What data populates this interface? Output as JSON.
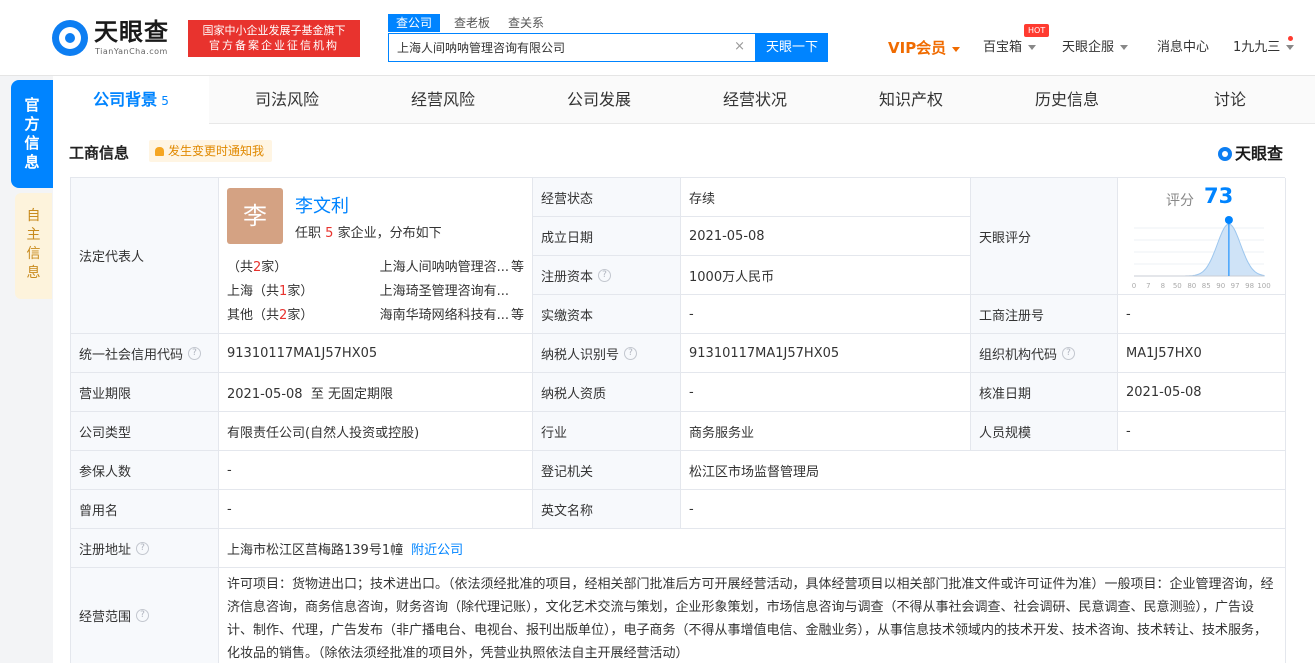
{
  "header": {
    "logo_text": "天眼查",
    "logo_sub": "TianYanCha.com",
    "gov_badge_line1": "国家中小企业发展子基金旗下",
    "gov_badge_line2": "官方备案企业征信机构",
    "search_tabs": [
      "查公司",
      "查老板",
      "查关系"
    ],
    "search_value": "上海人间呐呐管理咨询有限公司",
    "search_clear": "×",
    "search_button": "天眼一下",
    "nav": {
      "vip": "VIP会员",
      "treasure": "百宝箱",
      "hot": "HOT",
      "enterprise": "天眼企服",
      "messages": "消息中心",
      "user": "1九九三"
    }
  },
  "side": {
    "official": "官方信息",
    "self": "自主信息"
  },
  "tabs": [
    {
      "label": "公司背景",
      "count": "5"
    },
    {
      "label": "司法风险"
    },
    {
      "label": "经营风险"
    },
    {
      "label": "公司发展"
    },
    {
      "label": "经营状况"
    },
    {
      "label": "知识产权"
    },
    {
      "label": "历史信息"
    },
    {
      "label": "讨论"
    }
  ],
  "section": {
    "title": "工商信息",
    "notify": "发生变更时通知我",
    "brand": "天眼查"
  },
  "legal": {
    "label": "法定代表人",
    "avatar": "李",
    "name": "李文利",
    "sub_prefix": "任职",
    "sub_count": "5",
    "sub_suffix": "家企业，分布如下",
    "rows": [
      {
        "region": "",
        "count": "2",
        "company": "上海人间呐呐管理咨...",
        "etc": "等"
      },
      {
        "region": "上海",
        "count": "1",
        "company": "上海琦圣管理咨询有...",
        "etc": ""
      },
      {
        "region": "其他",
        "count": "2",
        "company": "海南华琦网络科技有...",
        "etc": "等"
      }
    ],
    "open_paren": "（共",
    "close_paren": "家）"
  },
  "fields": {
    "status_label": "经营状态",
    "status_value": "存续",
    "founded_label": "成立日期",
    "founded_value": "2021-05-08",
    "reg_capital_label": "注册资本",
    "reg_capital_value": "1000万人民币",
    "paid_capital_label": "实缴资本",
    "paid_capital_value": "-",
    "score_label": "天眼评分",
    "score_caption": "评分",
    "score_value": "73",
    "reg_no_label": "工商注册号",
    "reg_no_value": "-",
    "credit_code_label": "统一社会信用代码",
    "credit_code_value": "91310117MA1J57HX05",
    "taxpayer_id_label": "纳税人识别号",
    "taxpayer_id_value": "91310117MA1J57HX05",
    "org_code_label": "组织机构代码",
    "org_code_value": "MA1J57HX0",
    "term_label": "营业期限",
    "term_value": "2021-05-08  至 无固定期限",
    "taxpayer_qual_label": "纳税人资质",
    "taxpayer_qual_value": "-",
    "approve_label": "核准日期",
    "approve_value": "2021-05-08",
    "type_label": "公司类型",
    "type_value": "有限责任公司(自然人投资或控股)",
    "industry_label": "行业",
    "industry_value": "商务服务业",
    "staff_label": "人员规模",
    "staff_value": "-",
    "insured_label": "参保人数",
    "insured_value": "-",
    "authority_label": "登记机关",
    "authority_value": "松江区市场监督管理局",
    "former_label": "曾用名",
    "former_value": "-",
    "english_label": "英文名称",
    "english_value": "-",
    "address_label": "注册地址",
    "address_value": "上海市松江区莒梅路139号1幢",
    "address_link": "附近公司",
    "scope_label": "经营范围",
    "scope_value": "许可项目：货物进出口；技术进出口。（依法须经批准的项目，经相关部门批准后方可开展经营活动，具体经营项目以相关部门批准文件或许可证件为准）一般项目：企业管理咨询，经济信息咨询，商务信息咨询，财务咨询（除代理记账），文化艺术交流与策划，企业形象策划，市场信息咨询与调查（不得从事社会调查、社会调研、民意调查、民意测验），广告设计、制作、代理，广告发布（非广播电台、电视台、报刊出版单位），电子商务（不得从事增值电信、金融业务），从事信息技术领域内的技术开发、技术咨询、技术转让、技术服务，化妆品的销售。（除依法须经批准的项目外，凭营业执照依法自主开展经营活动）"
  },
  "score_chart": {
    "score": 73,
    "x_ticks": [
      "0",
      "7",
      "8",
      "50",
      "80",
      "85",
      "90",
      "97",
      "98",
      "100"
    ],
    "accent": "#0084ff"
  },
  "colors": {
    "brand": "#0084ff",
    "badge": "#e8332e",
    "vip": "#f06b00"
  }
}
